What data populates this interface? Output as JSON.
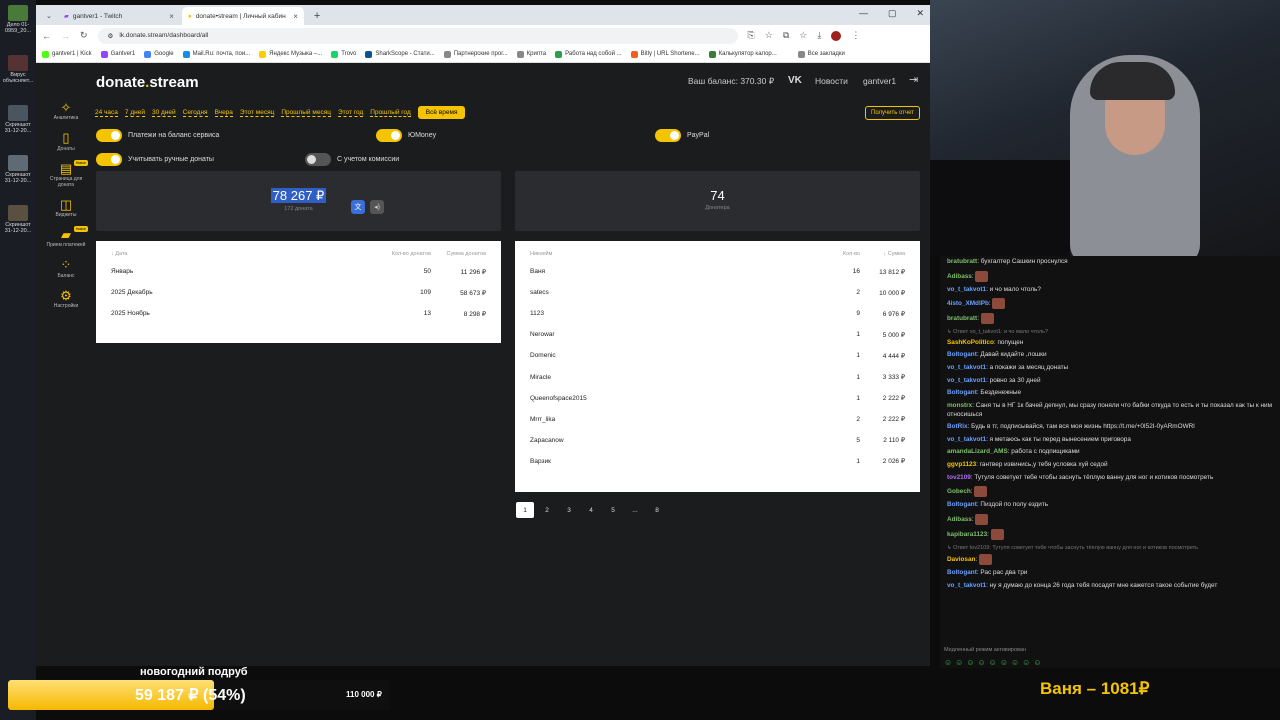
{
  "desktop": {
    "icons": [
      {
        "label": "Дело 01-0959_20...",
        "color": "#4a7a3a"
      },
      {
        "label": "Вирус объясняет...",
        "color": "#553333"
      },
      {
        "label": "Скриншот 31-12-20...",
        "color": "#4a5560"
      },
      {
        "label": "Скриншот 31-12-20...",
        "color": "#606a75"
      },
      {
        "label": "Скриншот 31-12-20...",
        "color": "#5a5040"
      }
    ]
  },
  "browser": {
    "tabs": [
      {
        "label": "gantver1 - Twitch",
        "active": false
      },
      {
        "label": "donate•stream | Личный кабин",
        "active": true
      }
    ],
    "new_tab": "+",
    "url": "lk.donate.stream/dashboard/all",
    "bookmarks": [
      {
        "label": "gantver1 | Kick",
        "color": "#53fc18"
      },
      {
        "label": "Gantver1",
        "color": "#9146ff"
      },
      {
        "label": "Google",
        "color": "#4285f4"
      },
      {
        "label": "Mail.Ru: почта, пои...",
        "color": "#168de2"
      },
      {
        "label": "Яндекс Музыка –...",
        "color": "#ffcc00"
      },
      {
        "label": "Trovo",
        "color": "#19d66b"
      },
      {
        "label": "SharkScope - Стати...",
        "color": "#0b5394"
      },
      {
        "label": "Партнерские прог...",
        "color": "#888888"
      },
      {
        "label": "Крипта",
        "color": "#888888"
      },
      {
        "label": "Работа над собой ...",
        "color": "#2e9e4a"
      },
      {
        "label": "Bitly | URL Shortene...",
        "color": "#ee6123"
      },
      {
        "label": "Калькулятор калор...",
        "color": "#3a7d3a"
      },
      {
        "label": "Все закладки",
        "color": "#888888"
      }
    ]
  },
  "site": {
    "logo_main": "donate",
    "logo_dot": ".",
    "logo_rest": "stream",
    "balance": "Ваш баланс: 370.30 ₽",
    "vk": "VK",
    "news": "Новости",
    "user": "gantver1",
    "sidebar": [
      {
        "label": "Аналитика",
        "icon": "✧",
        "badge": ""
      },
      {
        "label": "Донаты",
        "icon": "▯",
        "badge": ""
      },
      {
        "label": "Страница для доната",
        "icon": "▤",
        "badge": "Новое"
      },
      {
        "label": "Виджеты",
        "icon": "◫",
        "badge": ""
      },
      {
        "label": "Прием платежей",
        "icon": "▰",
        "badge": "Новое"
      },
      {
        "label": "Баланс",
        "icon": "⁘",
        "badge": ""
      },
      {
        "label": "Настройки",
        "icon": "⚙",
        "badge": ""
      }
    ],
    "periods": [
      "24 часа",
      "7 дней",
      "30 дней",
      "Сегодня",
      "Вчера",
      "Этот месяц",
      "Прошлый месяц",
      "Этот год",
      "Прошлый год",
      "Всё время"
    ],
    "report_button": "Получить отчет",
    "toggles": {
      "balance": "Платежи на баланс сервиса",
      "yoomoney": "ЮMoney",
      "paypal": "PayPal",
      "manual": "Учитывать ручные донаты",
      "commission": "С учетом комиссии"
    },
    "stats": {
      "total": "78 267 ₽",
      "total_sub": "172 доната",
      "donors": "74",
      "donors_sub": "Донатера"
    },
    "months_table": {
      "headers": [
        "↓ Дата",
        "Кол-во донатов",
        "Сумма донатов"
      ],
      "rows": [
        [
          "Январь",
          "50",
          "11 296 ₽"
        ],
        [
          "2025 Декабрь",
          "109",
          "58 673 ₽"
        ],
        [
          "2025 Ноябрь",
          "13",
          "8 298 ₽"
        ]
      ]
    },
    "donors_table": {
      "headers": [
        "Никнейм",
        "Кол-во",
        "↓ Сумма"
      ],
      "rows": [
        [
          "Ваня",
          "16",
          "13 812 ₽"
        ],
        [
          "satecs",
          "2",
          "10 000 ₽"
        ],
        [
          "1123",
          "9",
          "6 976 ₽"
        ],
        [
          "Nerowar",
          "1",
          "5 000 ₽"
        ],
        [
          "Domenic",
          "1",
          "4 444 ₽"
        ],
        [
          "Miracle",
          "1",
          "3 333 ₽"
        ],
        [
          "Queenofspace2015",
          "1",
          "2 222 ₽"
        ],
        [
          "Mrrr_lika",
          "2",
          "2 222 ₽"
        ],
        [
          "Zapacanow",
          "5",
          "2 110 ₽"
        ],
        [
          "Варзик",
          "1",
          "2 026 ₽"
        ]
      ]
    },
    "pagination": [
      "1",
      "2",
      "3",
      "4",
      "5",
      "...",
      "8"
    ]
  },
  "chat": {
    "messages": [
      {
        "user": "bratubratt",
        "color": "#7ec06b",
        "text": "бухгалтер Сашкин проснулся",
        "emote": false,
        "reply": ""
      },
      {
        "user": "Adibass",
        "color": "#7ec06b",
        "text": "",
        "emote": true,
        "reply": ""
      },
      {
        "user": "vo_t_takvot1",
        "color": "#6aa0ff",
        "text": "и чо мало чтоль?",
        "emote": false,
        "reply": ""
      },
      {
        "user": "4isto_XMdlPb",
        "color": "#6aa0ff",
        "text": "",
        "emote": true,
        "reply": ""
      },
      {
        "user": "bratubratt",
        "color": "#7ec06b",
        "text": "",
        "emote": true,
        "reply": ""
      },
      {
        "user": "SashKoPolitico",
        "color": "#f5c400",
        "text": "попущен",
        "emote": false,
        "reply": "↳ Ответ vo_t_takvot1: и чо мало чтоль?"
      },
      {
        "user": "Boltogant",
        "color": "#6aa0ff",
        "text": "Давай кидайте ,лошки",
        "emote": false,
        "reply": ""
      },
      {
        "user": "vo_t_takvot1",
        "color": "#6aa0ff",
        "text": "а покажи за месяц донаты",
        "emote": false,
        "reply": ""
      },
      {
        "user": "vo_t_takvot1",
        "color": "#6aa0ff",
        "text": "ровно за 30 дней",
        "emote": false,
        "reply": ""
      },
      {
        "user": "Boltogant",
        "color": "#6aa0ff",
        "text": "Безденежные",
        "emote": false,
        "reply": ""
      },
      {
        "user": "monstrx",
        "color": "#7ec06b",
        "text": "Саня ты в НГ 1к бачей депнул, мы сразу поняли что бабки откуда то есть и ты показал как ты к ним относишься",
        "emote": false,
        "reply": ""
      },
      {
        "user": "BotRix",
        "color": "#6aa0ff",
        "text": "Будь в тг, подписывайся, там вся моя жизнь https://t.me/+0I52I-0yARmOWRl",
        "emote": false,
        "reply": ""
      },
      {
        "user": "vo_t_takvot1",
        "color": "#6aa0ff",
        "text": "я метаюсь как ты перед вынесением приговора",
        "emote": false,
        "reply": ""
      },
      {
        "user": "amandaLizard_AMS",
        "color": "#7ec06b",
        "text": "работа с подпищиками",
        "emote": false,
        "reply": ""
      },
      {
        "user": "ggvp1123",
        "color": "#f5c400",
        "text": "гантвер извинись,у тебя условка хуй седой",
        "emote": false,
        "reply": ""
      },
      {
        "user": "tov2109",
        "color": "#b36bff",
        "text": "Тутуля советует тебе чтобы заснуть тёплую ванну для ног и котиков посмотреть",
        "emote": false,
        "reply": ""
      },
      {
        "user": "Gobech",
        "color": "#7ec06b",
        "text": "",
        "emote": true,
        "reply": ""
      },
      {
        "user": "Boltogant",
        "color": "#6aa0ff",
        "text": "Пиздой по полу ездить",
        "emote": false,
        "reply": ""
      },
      {
        "user": "Adibass",
        "color": "#7ec06b",
        "text": "",
        "emote": true,
        "reply": ""
      },
      {
        "user": "kapibara1123",
        "color": "#7ec06b",
        "text": "",
        "emote": true,
        "reply": ""
      },
      {
        "user": "Daviosan",
        "color": "#f5c400",
        "text": "",
        "emote": true,
        "reply": "↳ Ответ tov2109: Тутуля советует тебе чтобы заснуть тёплую ванну для ног и котиков посмотреть"
      },
      {
        "user": "Boltogant",
        "color": "#6aa0ff",
        "text": "Рас рас два три",
        "emote": false,
        "reply": ""
      },
      {
        "user": "vo_t_takvot1",
        "color": "#6aa0ff",
        "text": "ну я думаю до конца 26 года тебя посадят мне кажется такое событие будет",
        "emote": false,
        "reply": ""
      }
    ],
    "slow_mode": "Медленный режим активирован"
  },
  "overlay": {
    "goal_title": "новогодний подруб",
    "goal_progress": "59 187 ₽ (54%)",
    "goal_fraction": 0.54,
    "goal_target": "110 000 ₽",
    "top_donor": "Ваня – 1081₽"
  },
  "colors": {
    "accent": "#f5c400",
    "page_bg": "#1b1c1e",
    "card_bg": "#2b2c2f"
  }
}
